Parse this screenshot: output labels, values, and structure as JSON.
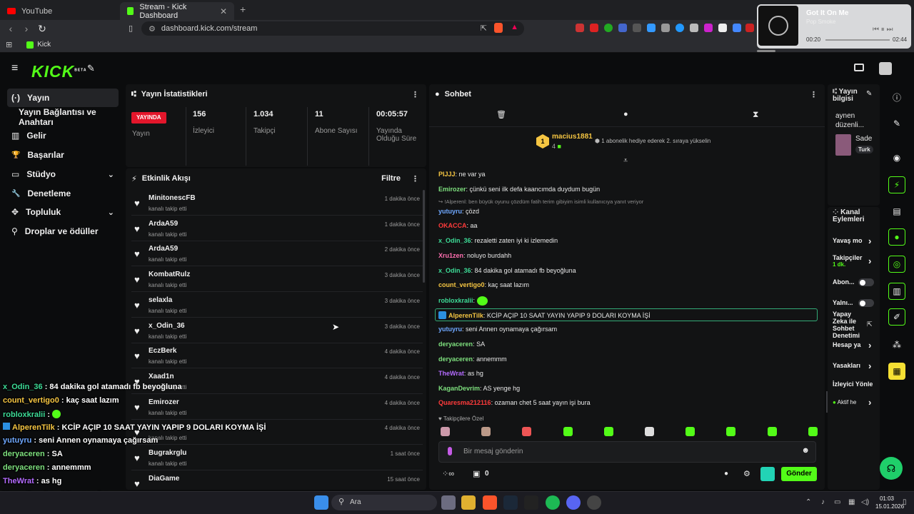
{
  "browser": {
    "tabs": [
      {
        "title": "YouTube",
        "active": false
      },
      {
        "title": "Stream - Kick Dashboard",
        "active": true
      }
    ],
    "url": "dashboard.kick.com/stream",
    "bookmark": "Kick"
  },
  "media": {
    "title": "Got It On Me",
    "artist": "Pop Smoke",
    "elapsed": "00:20",
    "total": "02:44"
  },
  "kick": {
    "logo": "KICK",
    "beta": "BETA"
  },
  "nav": [
    {
      "label": "Yayın",
      "icon": "(·)",
      "selected": true
    },
    {
      "label": "Yayın Bağlantısı ve Anahtarı",
      "icon": "",
      "selected": false
    },
    {
      "label": "Gelir",
      "icon": "▥",
      "selected": false
    },
    {
      "label": "Başarılar",
      "icon": "🏆",
      "selected": false
    },
    {
      "label": "Stüdyo",
      "icon": "▭",
      "selected": false,
      "expand": true
    },
    {
      "label": "Denetleme",
      "icon": "🔧",
      "selected": false
    },
    {
      "label": "Topluluk",
      "icon": "✥",
      "selected": false,
      "expand": true
    },
    {
      "label": "Droplar ve ödüller",
      "icon": "⚲",
      "selected": false
    }
  ],
  "stats": {
    "title": "Yayın İstatistikleri",
    "live_badge": "YAYINDA",
    "live_label": "Yayın",
    "viewers": "156",
    "viewers_label": "İzleyici",
    "followers": "1.034",
    "followers_label": "Takipçi",
    "subs": "11",
    "subs_label": "Abone Sayısı",
    "uptime": "00:05:57",
    "uptime_label": "Yayında Olduğu Süre"
  },
  "activity": {
    "title": "Etkinlik Akışı",
    "filter": "Filtre",
    "items": [
      {
        "name": "MinitonescFB",
        "action": "kanalı takip etti",
        "time": "1 dakika önce"
      },
      {
        "name": "ArdaA59",
        "action": "kanalı takip etti",
        "time": "1 dakika önce"
      },
      {
        "name": "ArdaA59",
        "action": "kanalı takip etti",
        "time": "2 dakika önce"
      },
      {
        "name": "KombatRulz",
        "action": "kanalı takip etti",
        "time": "3 dakika önce"
      },
      {
        "name": "selaxla",
        "action": "kanalı takip etti",
        "time": "3 dakika önce"
      },
      {
        "name": "x_Odin_36",
        "action": "kanalı takip etti",
        "time": "3 dakika önce"
      },
      {
        "name": "EczBerk",
        "action": "kanalı takip etti",
        "time": "4 dakika önce"
      },
      {
        "name": "Xaad1n",
        "action": "kanalı takip etti",
        "time": "4 dakika önce"
      },
      {
        "name": "Emirozer",
        "action": "kanalı takip etti",
        "time": "4 dakika önce"
      },
      {
        "name": "",
        "action": "kanalı takip etti",
        "time": "4 dakika önce"
      },
      {
        "name": "Bugrakrglu",
        "action": "kanalı takip etti",
        "time": "1 saat önce"
      },
      {
        "name": "DiaGame",
        "action": "",
        "time": "15 saat önce"
      }
    ]
  },
  "chat": {
    "title": "Sohbet",
    "pinned_user": "macius1881",
    "pinned_count": "4",
    "pinned_note": "1 abonelik hediye ederek 2. sıraya yükselin",
    "reply_note": "↪ !Alperenl: ben büyük oyunu çözdüm fatih terim gibiyim isimli kullanıcıya yanıt veriyor",
    "messages": [
      {
        "user": "PIJJJ",
        "color": "#f5c542",
        "text": "ne var ya"
      },
      {
        "user": "Emirozer",
        "color": "#7ee07e",
        "text": "çünkü seni ilk defa kaancımda duydum bugün"
      },
      {
        "user": "yutuyru",
        "color": "#6fa8ff",
        "text": "çözd"
      },
      {
        "user": "OKACCA",
        "color": "#ff3b3b",
        "text": "aa"
      },
      {
        "user": "x_Odin_36",
        "color": "#3ddc97",
        "text": "rezaletti zaten iyi ki izlemedin"
      },
      {
        "user": "Xru1zen",
        "color": "#ff6fb0",
        "text": "noluyo burdahh"
      },
      {
        "user": "x_Odin_36",
        "color": "#3ddc97",
        "text": "84 dakika gol atamadı fb beyoğluna"
      },
      {
        "user": "count_vertigo0",
        "color": "#f5c542",
        "text": "kaç saat lazım"
      },
      {
        "user": "robloxkralii",
        "color": "#3ddc97",
        "text": ""
      },
      {
        "user": "AlperenTilk",
        "color": "#f5c542",
        "text": "KCİP AÇIP 10 SAAT YAYIN YAPIP 9 DOLARI KOYMA İŞİ"
      },
      {
        "user": "yutuyru",
        "color": "#6fa8ff",
        "text": "seni Annen oynamaya çağırsam"
      },
      {
        "user": "deryaceren",
        "color": "#7ee07e",
        "text": "SA"
      },
      {
        "user": "deryaceren",
        "color": "#7ee07e",
        "text": "annemmm"
      },
      {
        "user": "TheWrat",
        "color": "#b46bff",
        "text": "as hg"
      },
      {
        "user": "KaganDevrim",
        "color": "#7ee07e",
        "text": "AS yenge hg"
      },
      {
        "user": "Quaresma212116",
        "color": "#ff3b3b",
        "text": "ozaman chet 5 saat yayın işi bura"
      }
    ],
    "follower_only": "Takipçilere Özel",
    "input_placeholder": "Bir mesaj gönderin",
    "count_zero": "0",
    "send": "Gönder"
  },
  "right": {
    "stream_info": "Yayın bilgisi",
    "stream_title": "aynen düzenli...",
    "category": "Sade",
    "tag": "Turk",
    "channel_actions": "Kanal Eylemleri",
    "actions": [
      {
        "label": "Yavaş mo"
      },
      {
        "label": "Takipçiler",
        "sub": "1 dk."
      },
      {
        "label": "Abon..."
      },
      {
        "label": "Yalnı..."
      },
      {
        "label": "Yapay Zeka ile Sohbet Denetimi"
      },
      {
        "label": "Hesap ya"
      },
      {
        "label": "Yasakları"
      },
      {
        "label": "İzleyici Yönle"
      },
      {
        "label": "Aktif he"
      }
    ]
  },
  "overlay": [
    {
      "user": "x_Odin_36",
      "color": "#3ddc97",
      "text": "84 dakika gol atamadı fb beyoğluna"
    },
    {
      "user": "count_vertigo0",
      "color": "#f5c542",
      "text": "kaç saat lazım"
    },
    {
      "user": "robloxkralii",
      "color": "#3ddc97",
      "text": ""
    },
    {
      "user": "AlperenTilk",
      "color": "#f5c542",
      "text": "KCİP AÇIP 10 SAAT YAYIN YAPIP 9 DOLARI KOYMA İŞİ"
    },
    {
      "user": "yutuyru",
      "color": "#6fa8ff",
      "text": "seni Annen oynamaya çağırsam"
    },
    {
      "user": "deryaceren",
      "color": "#7ee07e",
      "text": "SA"
    },
    {
      "user": "deryaceren",
      "color": "#7ee07e",
      "text": "annemmm"
    },
    {
      "user": "TheWrat",
      "color": "#b46bff",
      "text": "as hg"
    },
    {
      "user": "KaganDevrim",
      "color": "#7ee07e",
      "text": "AS yenge hg"
    },
    {
      "user": "Quaresma212116",
      "color": "#ff3b3b",
      "text": "ozaman chet 5 saat yayın işi bura"
    }
  ],
  "taskbar": {
    "search": "Ara",
    "time": "01:03",
    "date": "15.01.2026"
  },
  "colors": {
    "kick_green": "#53fc18",
    "live_red": "#e3162b",
    "bg": "#0b0c0d",
    "panel": "#121314"
  }
}
